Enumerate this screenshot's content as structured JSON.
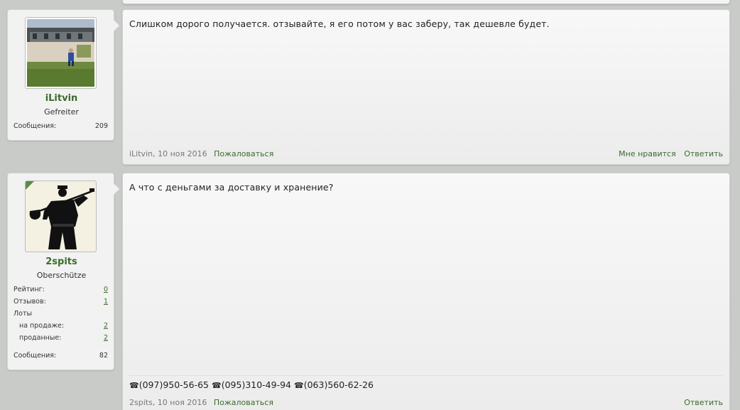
{
  "posts": [
    {
      "username": "iLitvin",
      "user_title": "Gefreiter",
      "stats": [
        {
          "label": "Сообщения:",
          "value": "209"
        }
      ],
      "message": "Слишком дорого получается. отзывайте, я его потом у вас заберу, так дешевле будет.",
      "author": "iLitvin",
      "date": ", 10 ноя 2016",
      "report_label": "Пожаловаться",
      "like_label": "Мне нравится",
      "reply_label": "Ответить"
    },
    {
      "username": "2spits",
      "user_title": "Oberschütze",
      "stats": [
        {
          "label": "Рейтинг:",
          "value": "0"
        },
        {
          "label": "Отзывов:",
          "value": "1"
        },
        {
          "label": "Лоты",
          "value": ""
        },
        {
          "label": "на продаже:",
          "value": "2"
        },
        {
          "label": "проданные:",
          "value": "2"
        },
        {
          "label": "Сообщения:",
          "value": "82"
        }
      ],
      "message": "А что с деньгами за доставку и хранение?",
      "signature": {
        "phone_icon": "☎",
        "phones": [
          "(097)950-56-65",
          "(095)310-49-94",
          "(063)560-62-26"
        ]
      },
      "author": "2spits",
      "date": ", 10 ноя 2016",
      "report_label": "Пожаловаться",
      "reply_label": "Ответить"
    }
  ],
  "colors": {
    "accent": "#3b6b2a",
    "background": "#c9cbc9",
    "panel": "#f2f2f2"
  },
  "icons": [
    "phone-icon",
    "avatar-photo-icon",
    "avatar-silhouette-icon"
  ]
}
